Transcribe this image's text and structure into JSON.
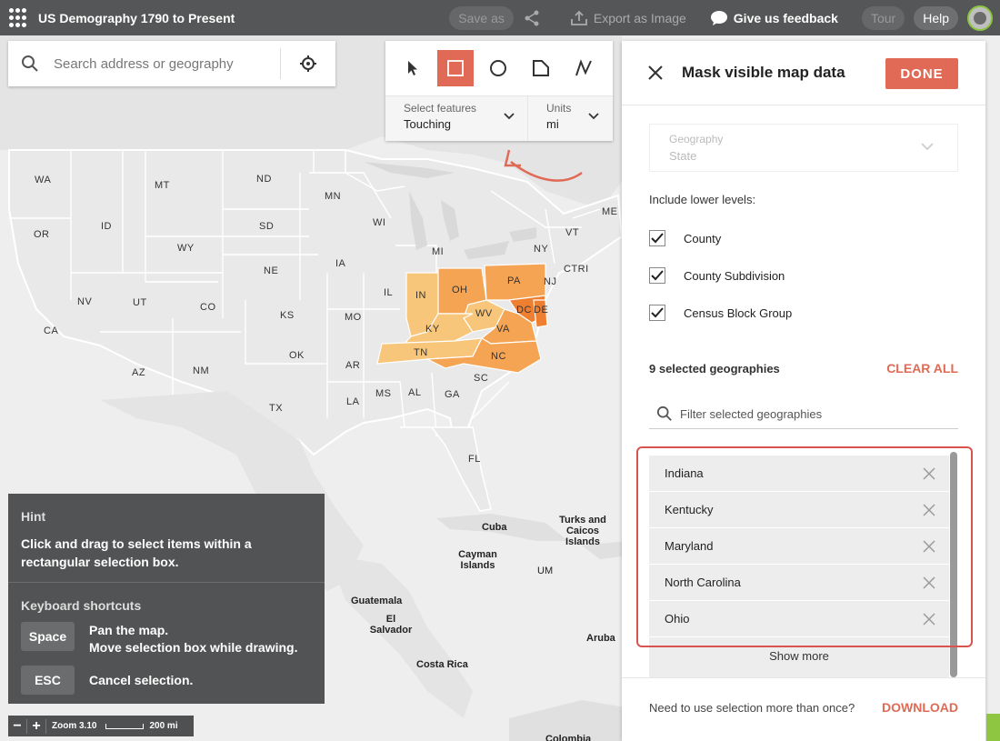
{
  "app": {
    "title": "US Demography 1790 to Present"
  },
  "topbar": {
    "save_as": "Save as",
    "export": "Export as Image",
    "feedback": "Give us feedback",
    "tour": "Tour",
    "help": "Help"
  },
  "search": {
    "placeholder": "Search address or geography"
  },
  "tools": {
    "select_features_label": "Select features",
    "select_features_value": "Touching",
    "units_label": "Units",
    "units_value": "mi",
    "active_tool": "rectangle"
  },
  "map": {
    "state_labels": [
      "WA",
      "MT",
      "ND",
      "MN",
      "ME",
      "OR",
      "ID",
      "SD",
      "WI",
      "VT",
      "WY",
      "MI",
      "NY",
      "CTRI",
      "IA",
      "NE",
      "PA",
      "NJ",
      "NV",
      "UT",
      "CO",
      "IL",
      "IN",
      "OH",
      "DC",
      "DE",
      "CA",
      "KS",
      "MO",
      "KY",
      "WV",
      "VA",
      "OK",
      "TN",
      "NC",
      "AZ",
      "NM",
      "AR",
      "SC",
      "MS",
      "AL",
      "GA",
      "TX",
      "LA",
      "FL"
    ],
    "place_labels": [
      "Turks and Caicos Islands",
      "Cuba",
      "Cayman Islands",
      "UM",
      "Guatemala",
      "El Salvador",
      "Aruba",
      "Costa Rica",
      "Colombia"
    ],
    "highlight_colors": {
      "light": "#f8c67a",
      "medium": "#f5a454",
      "dark": "#ee7f30"
    }
  },
  "hint": {
    "title": "Hint",
    "text": "Click and drag to select items within a rectangular selection box.",
    "shortcuts_title": "Keyboard shortcuts",
    "shortcuts": [
      {
        "key": "Space",
        "line1": "Pan the map.",
        "line2": "Move selection box while drawing."
      },
      {
        "key": "ESC",
        "line1": "Cancel selection.",
        "line2": ""
      }
    ]
  },
  "zoom": {
    "zoom_text": "Zoom 3.10",
    "scale_text": "200 mi"
  },
  "panel": {
    "title": "Mask visible map data",
    "done": "DONE",
    "geography_label": "Geography",
    "geography_value": "State",
    "include_label": "Include lower levels:",
    "levels": [
      {
        "label": "County",
        "checked": true
      },
      {
        "label": "County Subdivision",
        "checked": true
      },
      {
        "label": "Census Block Group",
        "checked": true
      }
    ],
    "selected_count": "9 selected geographies",
    "clear_all": "CLEAR ALL",
    "filter_placeholder": "Filter selected geographies",
    "selected": [
      "Indiana",
      "Kentucky",
      "Maryland",
      "North Carolina",
      "Ohio"
    ],
    "show_more": "Show more",
    "footer_text": "Need to use selection more than once?",
    "download": "DOWNLOAD",
    "accent_color": "#e06a55"
  }
}
